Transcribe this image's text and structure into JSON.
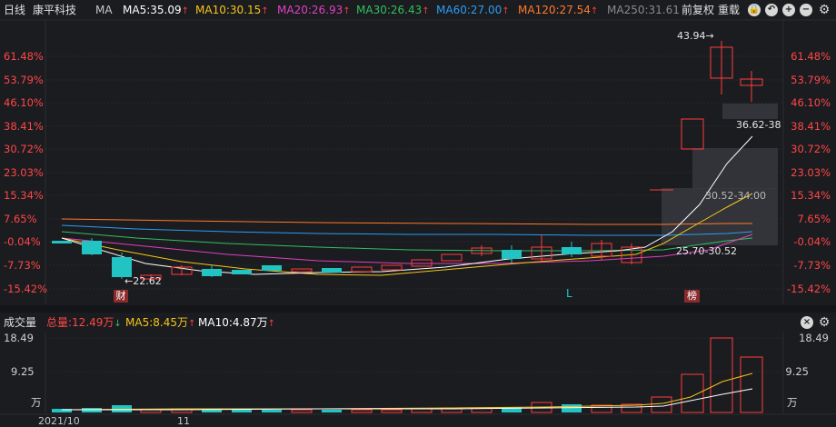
{
  "header": {
    "period": "日线",
    "stock_name": "康平科技",
    "ma_type": "MA",
    "ma_items": [
      {
        "label": "MA5:35.09",
        "color": "#ffffff"
      },
      {
        "label": "MA10:30.15",
        "color": "#f5c518"
      },
      {
        "label": "MA20:26.93",
        "color": "#e040c0"
      },
      {
        "label": "MA30:26.43",
        "color": "#30c060"
      },
      {
        "label": "MA60:27.00",
        "color": "#2a9df4"
      },
      {
        "label": "MA120:27.54",
        "color": "#ff7a2a"
      },
      {
        "label": "MA250:31.61",
        "color": "#8a8a8a"
      }
    ],
    "adjust": "前复权",
    "overlay": "重载",
    "up_arrow": "↑"
  },
  "axis_labels": [
    "61.48%",
    "53.79%",
    "46.10%",
    "38.41%",
    "30.72%",
    "23.03%",
    "15.34%",
    "7.65%",
    "-0.04%",
    "-7.73%",
    "-15.42%"
  ],
  "price_labels": {
    "high": "43.94→",
    "low": "←22.62",
    "zone1": "36.62-38",
    "zone2": "30.52-34.00",
    "zone3": "25.70-30.52"
  },
  "markers": {
    "cai": "财",
    "bang": "榜",
    "L": "L"
  },
  "volume_header": {
    "title": "成交量",
    "total": "总量:12.49万",
    "total_arrow": "↓",
    "ma5": "MA5:8.45万",
    "ma5_arrow": "↑",
    "ma10": "MA10:4.87万",
    "ma10_arrow": "↑"
  },
  "volume_axis": [
    "18.49",
    "9.25",
    "万"
  ],
  "dates": [
    "2021/10",
    "11"
  ],
  "colors": {
    "up": "#ff3c3c",
    "down": "#22c3c3",
    "bg": "#1b1c20",
    "axis": "#ff4646"
  }
}
